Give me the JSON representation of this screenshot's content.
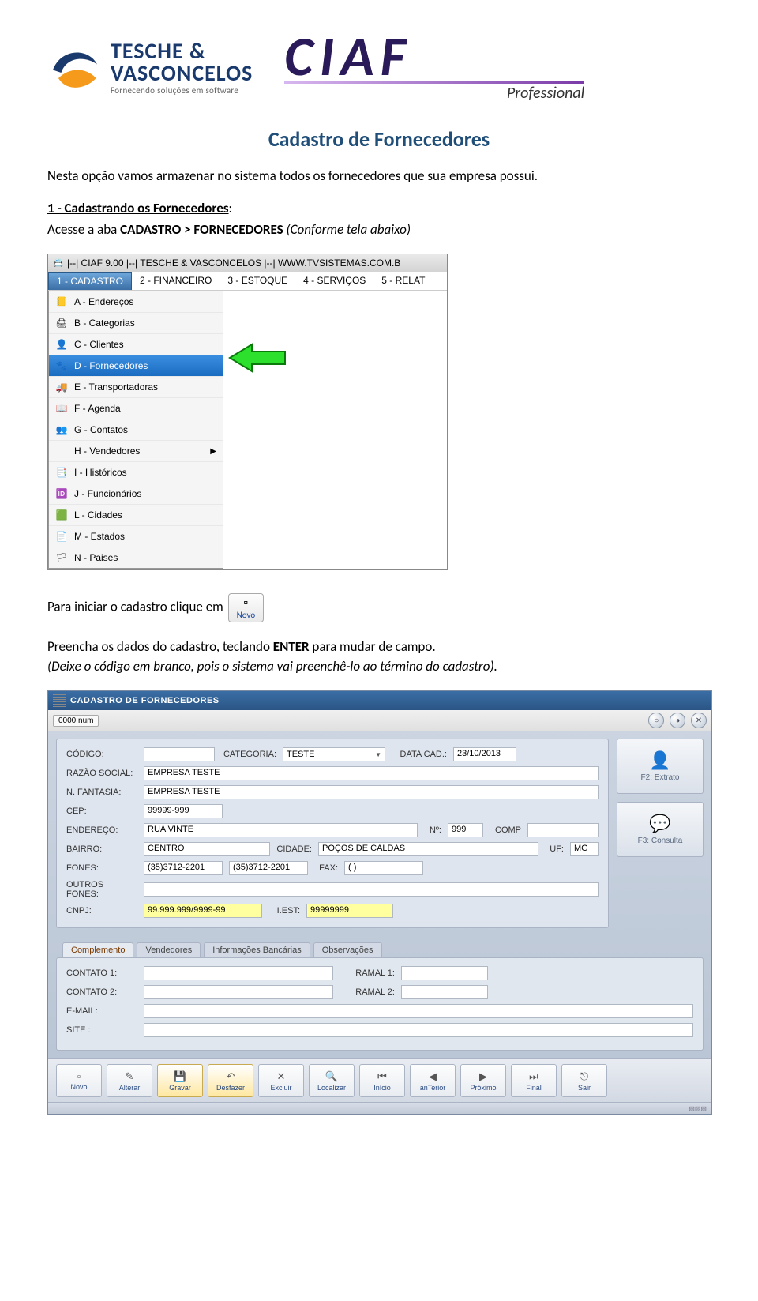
{
  "header": {
    "brand1_line1": "TESCHE &",
    "brand1_line2": "VASCONCELOS",
    "brand1_tagline": "Fornecendo soluções em software",
    "brand2_main": "CIAF",
    "brand2_sub": "Professional"
  },
  "doc": {
    "title": "Cadastro de Fornecedores",
    "intro": "Nesta opção vamos armazenar no sistema todos os fornecedores que sua empresa possui.",
    "section1_label": "1 - Cadastrando os Fornecedores",
    "section1_colon": ":",
    "section1_line": "Acesse a aba ",
    "section1_bold": "CADASTRO > FORNECEDORES ",
    "section1_tail": "(Conforme tela abaixo)",
    "after_menu_pre": "Para iniciar o cadastro clique em",
    "novo_label": "Novo",
    "fill_line_pre": "Preencha os dados do cadastro, teclando ",
    "fill_line_bold": "ENTER",
    "fill_line_post": " para mudar de campo.",
    "hint": "(Deixe o código em branco, pois o sistema vai preenchê-lo ao término do cadastro)."
  },
  "menu_app": {
    "window_title": "|--| CIAF 9.00 |--| TESCHE & VASCONCELOS |--| WWW.TVSISTEMAS.COM.B",
    "menubar": [
      "1 - CADASTRO",
      "2 - FINANCEIRO",
      "3 - ESTOQUE",
      "4 - SERVIÇOS",
      "5 - RELAT"
    ],
    "items": [
      {
        "icon": "📒",
        "label": "A - Endereços"
      },
      {
        "icon": "🖨",
        "label": "B - Categorias"
      },
      {
        "icon": "👤",
        "label": "C - Clientes"
      },
      {
        "icon": "🐾",
        "label": "D - Fornecedores"
      },
      {
        "icon": "🚚",
        "label": "E - Transportadoras"
      },
      {
        "icon": "📖",
        "label": "F - Agenda"
      },
      {
        "icon": "👥",
        "label": "G - Contatos"
      },
      {
        "icon": "",
        "label": "H - Vendedores"
      },
      {
        "icon": "📑",
        "label": "I - Históricos"
      },
      {
        "icon": "🆔",
        "label": "J - Funcionários"
      },
      {
        "icon": "🟩",
        "label": "L - Cidades"
      },
      {
        "icon": "📄",
        "label": "M - Estados"
      },
      {
        "icon": "🏳",
        "label": "N - Paises"
      }
    ]
  },
  "form_app": {
    "title": "CADASTRO DE FORNECEDORES",
    "subbar_tab": "0000 num",
    "side": {
      "f2": "F2: Extrato",
      "f3": "F3: Consulta"
    },
    "fields": {
      "codigo_lbl": "CÓDIGO:",
      "categoria_lbl": "CATEGORIA:",
      "categoria_val": "TESTE",
      "datacad_lbl": "DATA CAD.:",
      "datacad_val": "23/10/2013",
      "razao_lbl": "RAZÃO SOCIAL:",
      "razao_val": "EMPRESA TESTE",
      "fantasia_lbl": "N. FANTASIA:",
      "fantasia_val": "EMPRESA TESTE",
      "cep_lbl": "CEP:",
      "cep_val": "99999-999",
      "endereco_lbl": "ENDEREÇO:",
      "endereco_val": "RUA VINTE",
      "num_lbl": "Nº:",
      "num_val": "999",
      "comp_lbl": "COMP",
      "bairro_lbl": "BAIRRO:",
      "bairro_val": "CENTRO",
      "cidade_lbl": "CIDADE:",
      "cidade_val": "POÇOS DE CALDAS",
      "uf_lbl": "UF:",
      "uf_val": "MG",
      "fones_lbl": "FONES:",
      "fone1_val": "(35)3712-2201",
      "fone2_val": "(35)3712-2201",
      "fax_lbl": "FAX:",
      "fax_val": "(  )",
      "outros_lbl": "OUTROS FONES:",
      "cnpj_lbl": "CNPJ:",
      "cnpj_val": "99.999.999/9999-99",
      "iest_lbl": "I.EST:",
      "iest_val": "99999999"
    },
    "tabs": [
      "Complemento",
      "Vendedores",
      "Informações Bancárias",
      "Observações"
    ],
    "tabcontent": {
      "contato1_lbl": "CONTATO 1:",
      "contato2_lbl": "CONTATO 2:",
      "ramal1_lbl": "RAMAL 1:",
      "ramal2_lbl": "RAMAL 2:",
      "email_lbl": "E-MAIL:",
      "site_lbl": "SITE :"
    },
    "bottom": [
      {
        "icon": "▫",
        "label": "Novo"
      },
      {
        "icon": "✎",
        "label": "Alterar"
      },
      {
        "icon": "💾",
        "label": "Gravar"
      },
      {
        "icon": "↶",
        "label": "Desfazer"
      },
      {
        "icon": "✕",
        "label": "Excluir"
      },
      {
        "icon": "🔍",
        "label": "Localizar"
      },
      {
        "icon": "⏮",
        "label": "Início"
      },
      {
        "icon": "◀",
        "label": "anTerior"
      },
      {
        "icon": "▶",
        "label": "Próximo"
      },
      {
        "icon": "⏭",
        "label": "Final"
      },
      {
        "icon": "⎋",
        "label": "Sair"
      }
    ]
  }
}
